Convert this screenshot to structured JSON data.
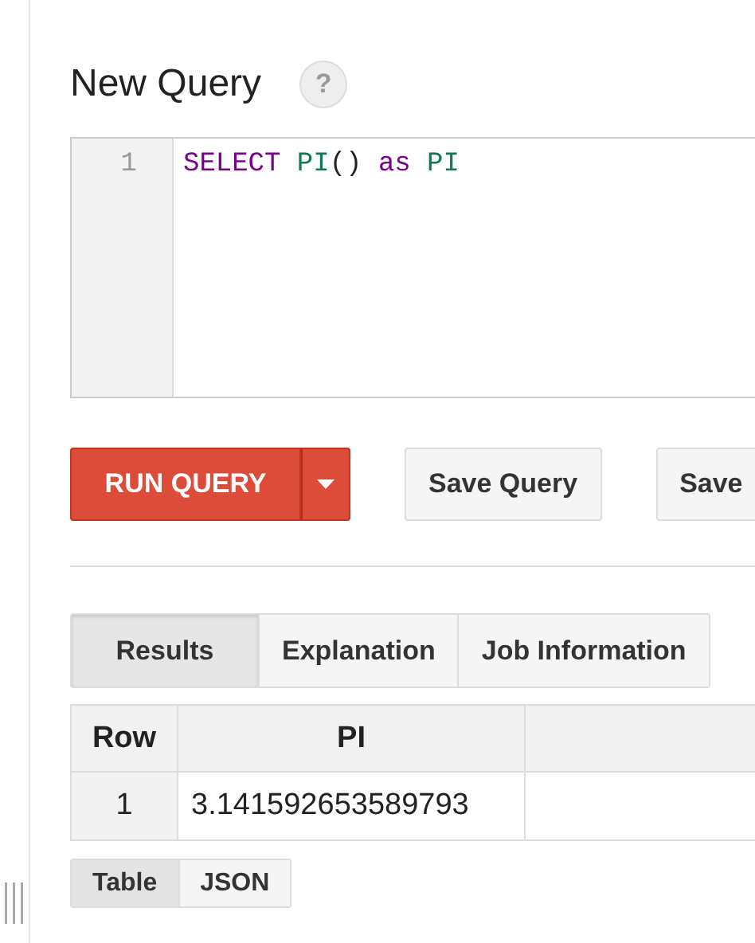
{
  "title": "New Query",
  "help": "?",
  "editor": {
    "lines": [
      {
        "number": "1",
        "tokens": [
          {
            "text": "SELECT",
            "kind": "keyword"
          },
          {
            "text": "PI",
            "kind": "function"
          },
          {
            "text": "()",
            "kind": "plain"
          },
          {
            "text": "as",
            "kind": "keyword"
          },
          {
            "text": "PI",
            "kind": "function"
          }
        ]
      }
    ]
  },
  "actions": {
    "run": "RUN QUERY",
    "buttons": [
      "Save Query",
      "Save"
    ]
  },
  "tabs": [
    {
      "label": "Results",
      "selected": true
    },
    {
      "label": "Explanation",
      "selected": false
    },
    {
      "label": "Job Information",
      "selected": false
    }
  ],
  "table": {
    "columns": [
      "Row",
      "PI"
    ],
    "rows": [
      [
        "1",
        "3.141592653589793"
      ]
    ]
  },
  "view_toggle": [
    {
      "label": "Table",
      "selected": true
    },
    {
      "label": "JSON",
      "selected": false
    }
  ]
}
